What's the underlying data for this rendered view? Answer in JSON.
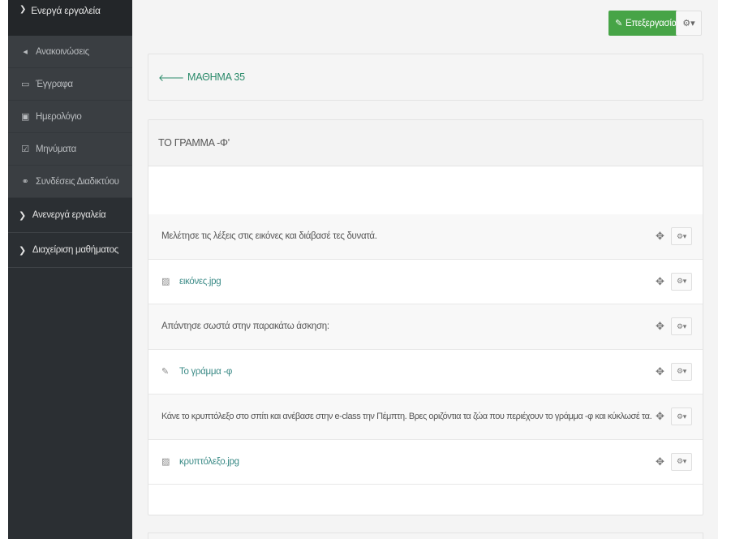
{
  "sidebar": {
    "active_group": {
      "label": "Ενεργά εργαλεία",
      "icon": "chevron-down-icon"
    },
    "items": [
      {
        "label": "Ανακοινώσεις",
        "icon": "bullhorn-icon",
        "glyph": "📢"
      },
      {
        "label": "Έγγραφα",
        "icon": "folder-open-icon",
        "glyph": "🗁"
      },
      {
        "label": "Ημερολόγιο",
        "icon": "calendar-icon",
        "glyph": "📅"
      },
      {
        "label": "Μηνύματα",
        "icon": "envelope-check-icon",
        "glyph": "☑"
      },
      {
        "label": "Συνδέσεις Διαδικτύου",
        "icon": "link-icon",
        "glyph": "🔗"
      }
    ],
    "groups": [
      {
        "label": "Ανενεργά εργαλεία",
        "icon": "chevron-right-icon"
      },
      {
        "label": "Διαχείριση μαθήματος",
        "icon": "chevron-right-icon"
      }
    ]
  },
  "toolbar": {
    "edit_label": "Επεξεργασία",
    "edit_icon": "edit-icon",
    "settings_icon": "cogs-icon"
  },
  "back_panel": {
    "label": "ΜΑΘΗΜΑ 35",
    "icon": "arrow-left-icon"
  },
  "section": {
    "title": "ΤΟ ΓΡΑΜΜΑ -Φ'",
    "rows": [
      {
        "type": "text",
        "text": "Μελέτησε τις λέξεις στις εικόνες και διάβασέ τες δυνατά."
      },
      {
        "type": "file",
        "text": "εικόνες.jpg",
        "icon": "image-file-icon"
      },
      {
        "type": "text",
        "text": "Απάντησε σωστά στην παρακάτω άσκηση:"
      },
      {
        "type": "exercise",
        "text": "Το γράμμα -φ",
        "icon": "edit-icon"
      },
      {
        "type": "text",
        "text": "Κάνε το κρυπτόλεξο στο σπίτι και ανέβασε στην e-class την Πέμπτη. Βρες οριζόντια τα ζώα που περιέχουν το γράμμα -φ και κύκλωσέ τα."
      },
      {
        "type": "file",
        "text": "κρυπτόλεξο.jpg",
        "icon": "image-file-icon"
      }
    ]
  },
  "colors": {
    "sidebar_bg": "#2b2f33",
    "edit_button": "#47a447",
    "link": "#3a8a86"
  }
}
